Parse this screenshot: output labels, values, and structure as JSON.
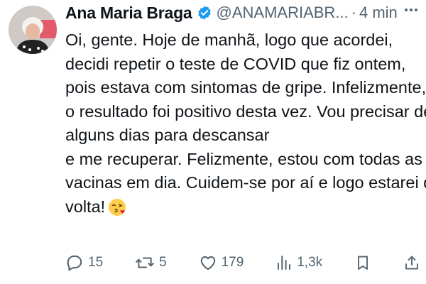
{
  "author": {
    "name": "Ana Maria Braga",
    "handle": "@ANAMARIABR...",
    "separator": "·",
    "time": "4 min",
    "verified": true
  },
  "tweet_text_lines": [
    "Oi, gente. Hoje de manhã, logo que acordei,",
    "decidi repetir o teste de COVID que fiz ontem,",
    "pois estava com sintomas de gripe. Infelizmente,",
    "o resultado foi positivo desta vez. Vou precisar de",
    "alguns dias para descansar",
    "e me recuperar. Felizmente, estou com todas as",
    "vacinas em dia. Cuidem-se por aí e logo estarei de",
    "volta!"
  ],
  "icons": {
    "more": "more-icon",
    "verified": "verified-badge-icon",
    "emoji": "face-blowing-kiss-emoji",
    "reply": "reply-icon",
    "retweet": "retweet-icon",
    "like": "heart-icon",
    "views": "views-icon",
    "bookmark": "bookmark-icon",
    "share": "share-icon"
  },
  "actions": {
    "replies": "15",
    "retweets": "5",
    "likes": "179",
    "views": "1,3k"
  },
  "colors": {
    "verified_blue": "#1d9bf0",
    "text": "#0f1419",
    "secondary": "#536471"
  }
}
